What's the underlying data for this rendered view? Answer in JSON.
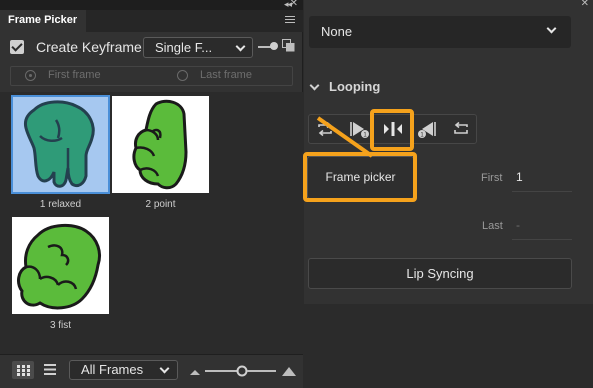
{
  "frame_picker": {
    "tab_label": "Frame Picker",
    "create_keyframe_label": "Create Keyframe",
    "mode_select_value": "Single F...",
    "first_frame_label": "First frame",
    "last_frame_label": "Last frame",
    "thumbnails": [
      {
        "label": "1 relaxed",
        "selected": true
      },
      {
        "label": "2 point",
        "selected": false
      },
      {
        "label": "3 fist",
        "selected": false
      }
    ],
    "frames_select_value": "All Frames",
    "selection_color": "#a6c8f0",
    "hand_color": "#5bbb3b"
  },
  "properties": {
    "symbol_dropdown_value": "None",
    "looping_label": "Looping",
    "loop_buttons": [
      {
        "icon": "loop-icon"
      },
      {
        "icon": "play-once-icon"
      },
      {
        "icon": "single-frame-icon",
        "highlighted": true
      },
      {
        "icon": "play-once-reverse-icon"
      },
      {
        "icon": "loop-reverse-icon"
      }
    ],
    "frame_picker_button_label": "Frame picker",
    "first_field_label": "First",
    "first_field_value": "1",
    "last_field_label": "Last",
    "last_field_value": "-",
    "lip_syncing_button_label": "Lip Syncing",
    "highlight_color": "#f5a21c"
  }
}
